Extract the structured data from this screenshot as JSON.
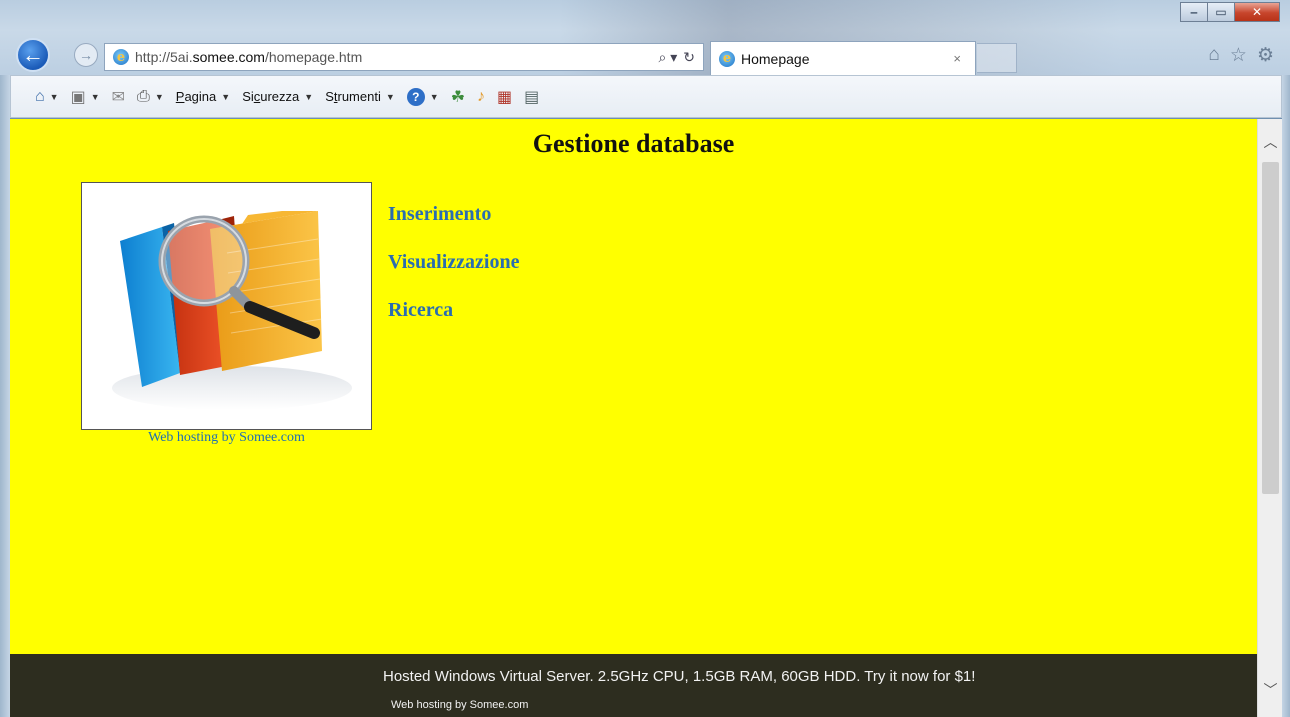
{
  "window": {
    "minimize_glyph": "‒",
    "maximize_glyph": "▭",
    "close_glyph": "✕"
  },
  "browser": {
    "back_glyph": "←",
    "forward_glyph": "→",
    "url_prefix": "http://5ai.",
    "url_domain": "somee.com",
    "url_path": "/homepage.htm",
    "address_tools": [
      "⌕ ▾",
      "↻"
    ],
    "tab_title": "Homepage",
    "tab_close": "×",
    "right_icons": [
      "home-icon",
      "favorites-star-icon",
      "settings-gear-icon"
    ]
  },
  "commandbar": {
    "items": [
      {
        "icon": "home-icon"
      },
      {
        "icon": "feeds-icon"
      },
      {
        "icon": "read-mail-icon"
      },
      {
        "icon": "print-icon"
      }
    ],
    "menus": [
      {
        "label": "Pagina",
        "access_key": "P"
      },
      {
        "label": "Sicurezza",
        "access_key": "c"
      },
      {
        "label": "Strumenti",
        "access_key": "t"
      }
    ],
    "extra_icons": [
      "help-icon",
      "research-icon",
      "music-icon",
      "chart-icon",
      "film-icon"
    ]
  },
  "page": {
    "title": "Gestione database",
    "hero_caption": "Web hosting by Somee.com",
    "nav": [
      "Inserimento",
      "Visualizzazione",
      "Ricerca"
    ],
    "background_color": "#ffff00",
    "link_color": "#2a6db0"
  },
  "footer": {
    "promo": "Hosted Windows Virtual Server. 2.5GHz CPU, 1.5GB RAM, 60GB HDD. Try it now for $1!",
    "host": "Web hosting by Somee.com"
  }
}
